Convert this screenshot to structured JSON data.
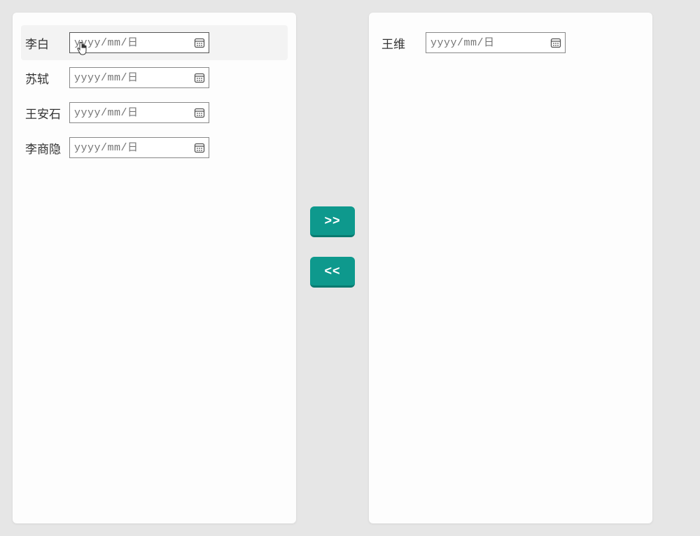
{
  "datePlaceholder": "yyyy/mm/日",
  "leftPanel": {
    "items": [
      {
        "label": "李白",
        "hover": true
      },
      {
        "label": "苏轼",
        "hover": false
      },
      {
        "label": "王安石",
        "hover": false
      },
      {
        "label": "李商隐",
        "hover": false
      }
    ]
  },
  "rightPanel": {
    "items": [
      {
        "label": "王维",
        "hover": false
      }
    ]
  },
  "buttons": {
    "moveRight": ">>",
    "moveLeft": "<<"
  },
  "colors": {
    "accent": "#0e998d",
    "background": "#e6e6e6",
    "panel": "#fdfdfd"
  }
}
